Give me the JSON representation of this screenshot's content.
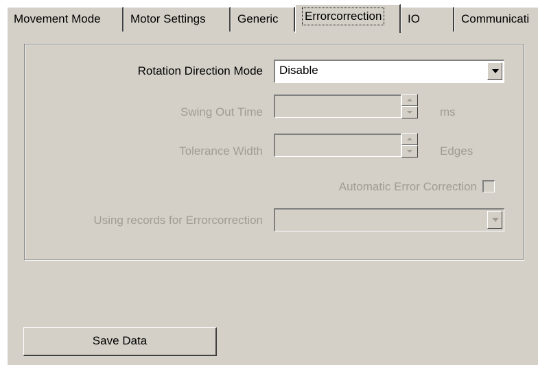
{
  "tabs": [
    {
      "label": "Movement Mode",
      "active": false
    },
    {
      "label": "Motor Settings",
      "active": false
    },
    {
      "label": "Generic",
      "active": false
    },
    {
      "label": "Errorcorrection",
      "active": true
    },
    {
      "label": "IO",
      "active": false
    },
    {
      "label": "Communicati",
      "active": false
    }
  ],
  "form": {
    "rotation_direction_mode": {
      "label": "Rotation Direction Mode",
      "value": "Disable",
      "enabled": true
    },
    "swing_out_time": {
      "label": "Swing Out Time",
      "value": "",
      "unit": "ms",
      "enabled": false
    },
    "tolerance_width": {
      "label": "Tolerance Width",
      "value": "",
      "unit": "Edges",
      "enabled": false
    },
    "automatic_error_correction": {
      "label": "Automatic Error Correction",
      "checked": false,
      "enabled": false
    },
    "using_records": {
      "label": "Using records for Errorcorrection",
      "value": "",
      "enabled": false
    }
  },
  "buttons": {
    "save_label": "Save Data"
  },
  "colors": {
    "face": "#d4d0c8",
    "disabled_text": "#a09c94",
    "shadow": "#808080",
    "highlight": "#ffffff"
  }
}
